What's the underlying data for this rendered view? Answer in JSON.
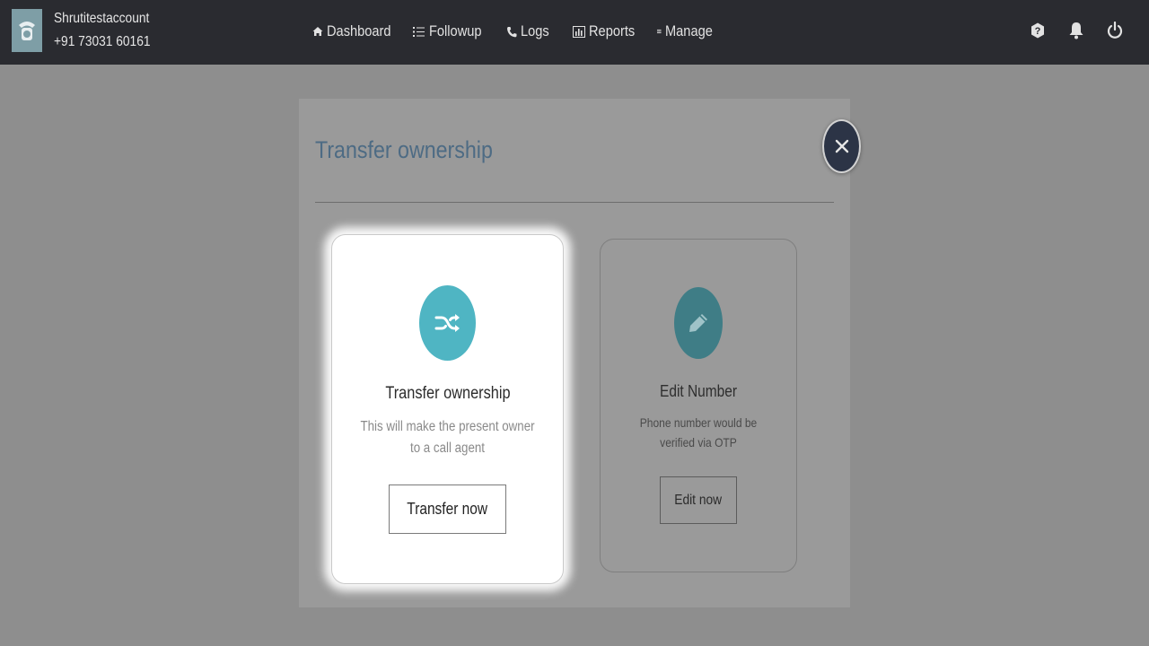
{
  "header": {
    "account_name": "Shrutitestaccount",
    "account_phone": "+91 73031 60161",
    "nav": [
      {
        "label": "Dashboard",
        "icon": "home-icon"
      },
      {
        "label": "Followup",
        "icon": "list-icon"
      },
      {
        "label": "Logs",
        "icon": "phone-icon"
      },
      {
        "label": "Reports",
        "icon": "bar-chart-icon"
      },
      {
        "label": "Manage",
        "icon": "menu-icon"
      }
    ],
    "right_icons": [
      "help-icon",
      "bell-icon",
      "power-icon"
    ]
  },
  "modal": {
    "title": "Transfer ownership",
    "close_icon": "close-icon",
    "cards": [
      {
        "icon": "shuffle-icon",
        "heading": "Transfer ownership",
        "description": "This will make the present owner to a call agent",
        "button": "Transfer now"
      },
      {
        "icon": "pencil-icon",
        "heading": "Edit Number",
        "description": "Phone number would be verified via OTP",
        "button": "Edit now"
      }
    ]
  },
  "colors": {
    "header_bg": "#2a2b30",
    "overlay": "#8e8e8e",
    "accent_teal": "#4fb5c3",
    "title_blue": "#4d6b84",
    "close_bg": "#2c3446"
  }
}
